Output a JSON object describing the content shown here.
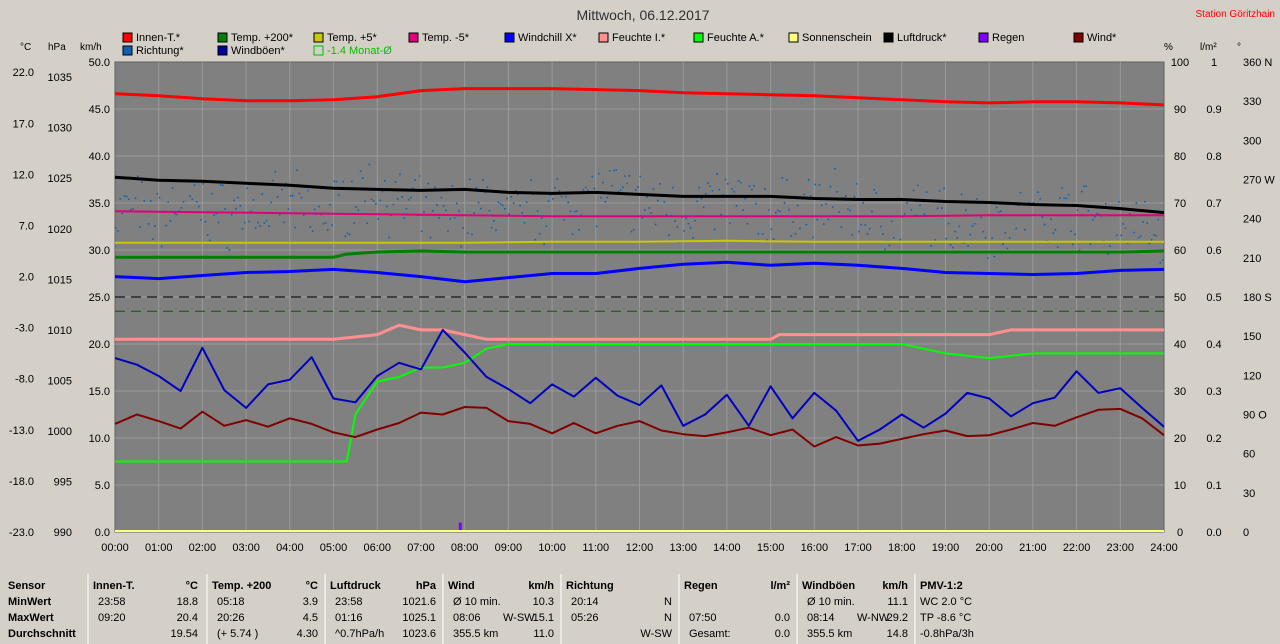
{
  "header": {
    "title": "Mittwoch, 06.12.2017",
    "station": "Station Göritzhain"
  },
  "legend": [
    {
      "label": "Innen-T.*",
      "color": "#ff0000"
    },
    {
      "label": "Temp. +200*",
      "color": "#008000"
    },
    {
      "label": "Temp. +5*",
      "color": "#c8c800"
    },
    {
      "label": "Temp. -5*",
      "color": "#e0007a"
    },
    {
      "label": "Windchill X*",
      "color": "#0000ff"
    },
    {
      "label": "Feuchte I.*",
      "color": "#ff9090"
    },
    {
      "label": "Feuchte A.*",
      "color": "#00ff00"
    },
    {
      "label": "Sonnenschein",
      "color": "#ffff80"
    },
    {
      "label": "Luftdruck*",
      "color": "#000000"
    },
    {
      "label": "Regen",
      "color": "#8000ff"
    },
    {
      "label": "Wind*",
      "color": "#800000"
    },
    {
      "label": "Richtung*",
      "color": "#1060b0"
    },
    {
      "label": "Windböen*",
      "color": "#0000a0"
    },
    {
      "label": "-1.4 Monat-Ø",
      "color": "#00c000"
    }
  ],
  "axis_units": {
    "celsius": "°C",
    "hpa": "hPa",
    "kmh": "km/h",
    "percent": "%",
    "rain": "l/m²",
    "degree": "°"
  },
  "chart_data": {
    "type": "line",
    "x_ticks": [
      "00:00",
      "01:00",
      "02:00",
      "03:00",
      "04:00",
      "05:00",
      "06:00",
      "07:00",
      "08:00",
      "09:00",
      "10:00",
      "11:00",
      "12:00",
      "13:00",
      "14:00",
      "15:00",
      "16:00",
      "17:00",
      "18:00",
      "19:00",
      "20:00",
      "21:00",
      "22:00",
      "23:00",
      "24:00"
    ],
    "axes": {
      "temp_c": {
        "ticks": [
          "22.0",
          "17.0",
          "12.0",
          "7.0",
          "2.0",
          "-3.0",
          "-8.0",
          "-13.0",
          "-18.0",
          "-23.0"
        ],
        "range": [
          -23,
          23
        ]
      },
      "pressure_hpa": {
        "ticks": [
          "1035",
          "1030",
          "1025",
          "1020",
          "1015",
          "1010",
          "1005",
          "1000",
          "995",
          "990"
        ],
        "range": [
          990,
          1036.5
        ]
      },
      "wind_kmh": {
        "ticks": [
          "50.0",
          "45.0",
          "40.0",
          "35.0",
          "30.0",
          "25.0",
          "20.0",
          "15.0",
          "10.0",
          "5.0",
          "0.0"
        ],
        "range": [
          0,
          50
        ]
      },
      "humidity_pct": {
        "ticks": [
          "100",
          "90",
          "80",
          "70",
          "60",
          "50",
          "40",
          "30",
          "20",
          "10",
          "0"
        ],
        "range": [
          0,
          100
        ]
      },
      "rain_lm2": {
        "ticks": [
          "1",
          "0.9",
          "0.8",
          "0.7",
          "0.6",
          "0.5",
          "0.4",
          "0.3",
          "0.2",
          "0.1",
          "0.0"
        ],
        "range": [
          0,
          1
        ]
      },
      "direction_deg": {
        "ticks": [
          "360 N",
          "330",
          "300",
          "270 W",
          "240",
          "210",
          "180 S",
          "150",
          "120",
          "90 O",
          "60",
          "30",
          "0"
        ],
        "range": [
          0,
          360
        ]
      }
    },
    "series": [
      {
        "name": "Innen-T.*",
        "axis": "temp_c",
        "color": "#ff0000",
        "width": 3,
        "x": [
          0,
          1,
          2,
          3,
          4,
          5,
          6,
          7,
          8,
          9,
          10,
          11,
          12,
          13,
          14,
          15,
          16,
          17,
          18,
          19,
          20,
          21,
          22,
          23,
          24
        ],
        "y": [
          19.9,
          19.7,
          19.4,
          19.2,
          19.2,
          19.3,
          19.6,
          20.2,
          20.4,
          20.4,
          20.4,
          20.3,
          20.2,
          20.0,
          19.9,
          19.8,
          19.7,
          19.5,
          19.3,
          19.1,
          19.0,
          19.1,
          19.1,
          19.0,
          18.8
        ]
      },
      {
        "name": "Temp. +200*",
        "axis": "temp_c",
        "color": "#008000",
        "width": 3,
        "x": [
          0,
          1,
          2,
          3,
          4,
          5,
          5.3,
          6,
          7,
          8,
          9,
          10,
          11,
          12,
          13,
          14,
          15,
          16,
          17,
          18,
          19,
          20,
          21,
          22,
          23,
          24
        ],
        "y": [
          3.9,
          3.9,
          3.9,
          3.9,
          3.9,
          3.9,
          4.2,
          4.4,
          4.5,
          4.4,
          4.4,
          4.4,
          4.4,
          4.4,
          4.4,
          4.4,
          4.4,
          4.4,
          4.4,
          4.4,
          4.4,
          4.4,
          4.4,
          4.4,
          4.4,
          4.5
        ]
      },
      {
        "name": "Temp. +5*",
        "axis": "temp_c",
        "color": "#c8c800",
        "width": 2,
        "x": [
          0,
          2,
          4,
          6,
          8,
          10,
          12,
          14,
          16,
          18,
          20,
          22,
          24
        ],
        "y": [
          5.3,
          5.3,
          5.3,
          5.3,
          5.3,
          5.4,
          5.4,
          5.5,
          5.4,
          5.4,
          5.4,
          5.4,
          5.4
        ]
      },
      {
        "name": "Temp. -5*",
        "axis": "temp_c",
        "color": "#e0007a",
        "width": 2,
        "x": [
          0,
          2,
          4,
          6,
          8,
          10,
          12,
          14,
          16,
          18,
          20,
          22,
          24
        ],
        "y": [
          8.4,
          8.3,
          8.2,
          8.1,
          8.0,
          7.9,
          7.9,
          7.9,
          7.9,
          7.9,
          8.0,
          8.0,
          8.0
        ]
      },
      {
        "name": "Windchill X*",
        "axis": "temp_c",
        "color": "#0000ff",
        "width": 3,
        "x": [
          0,
          1,
          2,
          3,
          4,
          5,
          6,
          7,
          8,
          9,
          10,
          11,
          12,
          13,
          14,
          15,
          16,
          17,
          18,
          19,
          20,
          21,
          22,
          23,
          24
        ],
        "y": [
          2.0,
          1.8,
          2.1,
          2.4,
          2.5,
          2.7,
          2.4,
          2.0,
          1.5,
          1.9,
          2.3,
          2.3,
          2.8,
          3.2,
          3.4,
          3.1,
          3.3,
          3.1,
          2.8,
          2.4,
          2.3,
          2.2,
          2.3,
          2.6,
          2.7
        ]
      },
      {
        "name": "Luftdruck*",
        "axis": "pressure_hpa",
        "color": "#000000",
        "width": 3,
        "x": [
          0,
          1,
          2,
          3,
          4,
          5,
          6,
          7,
          8,
          9,
          10,
          11,
          12,
          13,
          14,
          15,
          16,
          17,
          18,
          19,
          20,
          21,
          22,
          23,
          24
        ],
        "y": [
          1025.1,
          1024.8,
          1024.7,
          1024.5,
          1024.3,
          1024.0,
          1023.9,
          1023.8,
          1023.9,
          1023.6,
          1023.5,
          1023.6,
          1023.4,
          1023.2,
          1023.2,
          1023.2,
          1023.0,
          1022.9,
          1022.9,
          1022.7,
          1022.6,
          1022.4,
          1022.3,
          1022.0,
          1021.6
        ]
      },
      {
        "name": "Feuchte I.*",
        "axis": "humidity_pct",
        "color": "#ff9090",
        "width": 3,
        "x": [
          0,
          5,
          6,
          6.5,
          7,
          7.5,
          8,
          8.5,
          9,
          10,
          11,
          12,
          13,
          14,
          15,
          15.2,
          16,
          17,
          18,
          19,
          20,
          20.5,
          21,
          22,
          23,
          24
        ],
        "y": [
          41,
          41,
          42,
          44,
          43,
          43,
          42,
          41,
          41,
          41,
          41,
          41,
          41,
          41,
          41,
          42,
          42,
          42,
          42,
          42,
          42,
          43,
          43,
          43,
          43,
          43
        ]
      },
      {
        "name": "Feuchte A.*",
        "axis": "humidity_pct",
        "color": "#00ff00",
        "width": 2,
        "x": [
          0,
          5.3,
          5.5,
          6,
          6.5,
          7,
          7.5,
          8,
          8.5,
          9,
          10,
          11,
          12,
          13,
          14,
          15,
          16,
          17,
          18,
          18.5,
          19,
          20,
          21,
          22,
          23,
          24
        ],
        "y": [
          15,
          15,
          25,
          32,
          33,
          35,
          35,
          36,
          39,
          40,
          40,
          40,
          40,
          40,
          40,
          40,
          40,
          40,
          40,
          39,
          38,
          37,
          38,
          38,
          38,
          38
        ]
      },
      {
        "name": "Wind*",
        "axis": "wind_kmh",
        "color": "#800000",
        "width": 2,
        "x": [
          0,
          0.5,
          1,
          1.5,
          2,
          2.5,
          3,
          3.5,
          4,
          4.5,
          5,
          5.5,
          6,
          6.5,
          7,
          7.5,
          8,
          8.5,
          9,
          9.5,
          10,
          10.5,
          11,
          11.5,
          12,
          12.5,
          13,
          13.5,
          14,
          14.5,
          15,
          15.5,
          16,
          16.5,
          17,
          17.5,
          18,
          18.5,
          19,
          19.5,
          20,
          20.5,
          21,
          21.5,
          22,
          22.5,
          23,
          23.5,
          24
        ],
        "y": [
          11.5,
          12.5,
          11.8,
          11.0,
          12.8,
          11.3,
          11.9,
          11.2,
          12.1,
          11.5,
          10.6,
          10.1,
          10.9,
          11.6,
          12.7,
          12.5,
          13.3,
          13.2,
          11.8,
          11.5,
          10.5,
          11.6,
          10.5,
          11.3,
          11.8,
          10.8,
          10.4,
          10.2,
          10.6,
          11.1,
          10.3,
          10.9,
          9.1,
          10.1,
          9.2,
          9.4,
          9.9,
          10.4,
          10.8,
          10.2,
          10.3,
          10.9,
          11.6,
          11.3,
          12.2,
          13.0,
          13.1,
          12.1,
          10.3
        ]
      },
      {
        "name": "Windböen*",
        "axis": "wind_kmh",
        "color": "#0000c0",
        "width": 2,
        "x": [
          0,
          0.5,
          1,
          1.5,
          2,
          2.5,
          3,
          3.5,
          4,
          4.5,
          5,
          5.5,
          6,
          6.5,
          7,
          7.5,
          8,
          8.5,
          9,
          9.5,
          10,
          10.5,
          11,
          11.5,
          12,
          12.5,
          13,
          13.5,
          14,
          14.5,
          15,
          15.5,
          16,
          16.5,
          17,
          17.5,
          18,
          18.5,
          19,
          19.5,
          20,
          20.5,
          21,
          21.5,
          22,
          22.5,
          23,
          23.5,
          24
        ],
        "y": [
          18.5,
          17.8,
          16.6,
          15.0,
          19.6,
          15.1,
          13.2,
          15.7,
          16.2,
          18.6,
          14.2,
          13.8,
          16.6,
          18.0,
          17.3,
          21.5,
          19.1,
          16.5,
          15.2,
          13.7,
          15.7,
          14.4,
          16.4,
          14.5,
          13.5,
          15.6,
          11.3,
          12.5,
          14.6,
          11.3,
          15.5,
          12.1,
          14.8,
          12.9,
          9.7,
          10.9,
          12.5,
          11.1,
          12.6,
          14.8,
          14.2,
          12.3,
          13.7,
          14.3,
          17.1,
          14.8,
          15.3,
          13.2,
          11.2
        ]
      },
      {
        "name": "Regen",
        "axis": "rain_lm2",
        "color": "#8000ff",
        "width": 3,
        "x": [
          7.9,
          7.9
        ],
        "y": [
          0,
          0.02
        ]
      }
    ],
    "reference_lines": [
      {
        "axis": "temp_c",
        "value": 0.0,
        "color": "#000000",
        "dash": "10,6"
      },
      {
        "axis": "temp_c",
        "value": -1.4,
        "color": "#006000",
        "dash": "10,6"
      }
    ],
    "direction_scatter": {
      "name": "Richtung*",
      "axis": "direction_deg",
      "color": "#1060b0",
      "x": [
        0,
        0.5,
        1,
        1.5,
        2,
        2.5,
        3,
        3.5,
        4,
        4.5,
        5,
        5.5,
        6,
        6.5,
        7,
        7.5,
        8,
        8.5,
        9,
        9.5,
        10,
        10.5,
        11,
        11.5,
        12,
        12.5,
        13,
        13.5,
        14,
        14.5,
        15,
        15.5,
        16,
        16.5,
        17,
        17.5,
        18,
        18.5,
        19,
        19.5,
        20,
        20.5,
        21,
        21.5,
        22,
        22.5,
        23,
        23.5,
        24
      ],
      "y": [
        245,
        250,
        240,
        255,
        248,
        242,
        250,
        246,
        252,
        240,
        248,
        258,
        262,
        250,
        245,
        240,
        248,
        252,
        240,
        245,
        250,
        255,
        260,
        258,
        252,
        248,
        245,
        250,
        255,
        248,
        244,
        250,
        248,
        252,
        246,
        240,
        242,
        246,
        238,
        242,
        235,
        240,
        238,
        244,
        246,
        238,
        240,
        232,
        228
      ]
    }
  },
  "table": {
    "headers": [
      {
        "label": "Sensor",
        "unit": ""
      },
      {
        "label": "Innen-T.",
        "unit": "°C"
      },
      {
        "label": "Temp. +200",
        "unit": "°C"
      },
      {
        "label": "Luftdruck",
        "unit": "hPa"
      },
      {
        "label": "Wind",
        "unit": "km/h"
      },
      {
        "label": "Richtung",
        "unit": ""
      },
      {
        "label": "Regen",
        "unit": "l/m²"
      },
      {
        "label": "Windböen",
        "unit": "km/h"
      },
      {
        "label": "PMV-1:2",
        "unit": ""
      }
    ],
    "row_labels": [
      "MinWert",
      "MaxWert",
      "Durchschnitt"
    ],
    "rows": [
      [
        [
          "23:58",
          "18.8"
        ],
        [
          "05:18",
          "3.9"
        ],
        [
          "23:58",
          "1021.6"
        ],
        [
          "Ø 10 min.",
          "",
          "10.3"
        ],
        [
          "20:14",
          "",
          "N"
        ],
        [
          "",
          "",
          ""
        ],
        [
          "Ø 10 min.",
          "",
          "11.1"
        ],
        [
          "WC 2.0 °C"
        ]
      ],
      [
        [
          "09:20",
          "20.4"
        ],
        [
          "20:26",
          "4.5"
        ],
        [
          "01:16",
          "1025.1"
        ],
        [
          "08:06",
          "W-SW",
          "15.1"
        ],
        [
          "05:26",
          "",
          "N"
        ],
        [
          "07:50",
          "",
          "0.0"
        ],
        [
          "08:14",
          "W-NW",
          "29.2"
        ],
        [
          "TP -8.6 °C"
        ]
      ],
      [
        [
          "",
          "19.54"
        ],
        [
          "(+ 5.74 )",
          "4.30"
        ],
        [
          "^0.7hPa/h",
          "1023.6"
        ],
        [
          "355.5 km",
          "",
          "11.0"
        ],
        [
          "",
          "",
          "W-SW"
        ],
        [
          "Gesamt:",
          "",
          "0.0"
        ],
        [
          "355.5 km",
          "",
          "14.8"
        ],
        [
          "-0.8hPa/3h"
        ]
      ]
    ]
  }
}
